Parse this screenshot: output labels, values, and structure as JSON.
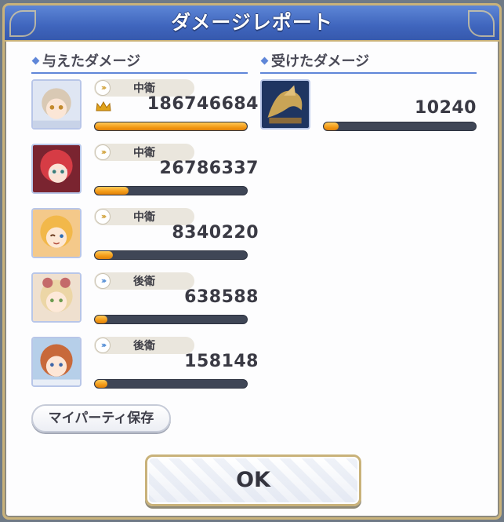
{
  "window": {
    "title": "ダメージレポート"
  },
  "sections": {
    "dealt": {
      "label": "与えたダメージ"
    },
    "taken": {
      "label": "受けたダメージ"
    }
  },
  "dealt_rows": [
    {
      "position": "中衛",
      "position_type": "front",
      "damage": "186746684",
      "fill": 1.0,
      "top": true
    },
    {
      "position": "中衛",
      "position_type": "front",
      "damage": "26786337",
      "fill": 0.22
    },
    {
      "position": "中衛",
      "position_type": "front",
      "damage": "8340220",
      "fill": 0.12
    },
    {
      "position": "後衛",
      "position_type": "back",
      "damage": "638588",
      "fill": 0.08
    },
    {
      "position": "後衛",
      "position_type": "back",
      "damage": "158148",
      "fill": 0.08
    }
  ],
  "taken_rows": [
    {
      "damage": "10240",
      "fill": 0.1
    }
  ],
  "buttons": {
    "save_party": "マイパーティ保存",
    "ok": "OK"
  },
  "colors": {
    "title_bar": "#4570c4",
    "bar_fill": "#f39a16",
    "bar_track": "#3f4656",
    "accent_gold": "#c9b27a"
  },
  "icons": {
    "mid_position": "chevron-right-icon (gold)",
    "back_position": "chevron-right-icon (blue)",
    "top_damage": "crown-icon"
  }
}
